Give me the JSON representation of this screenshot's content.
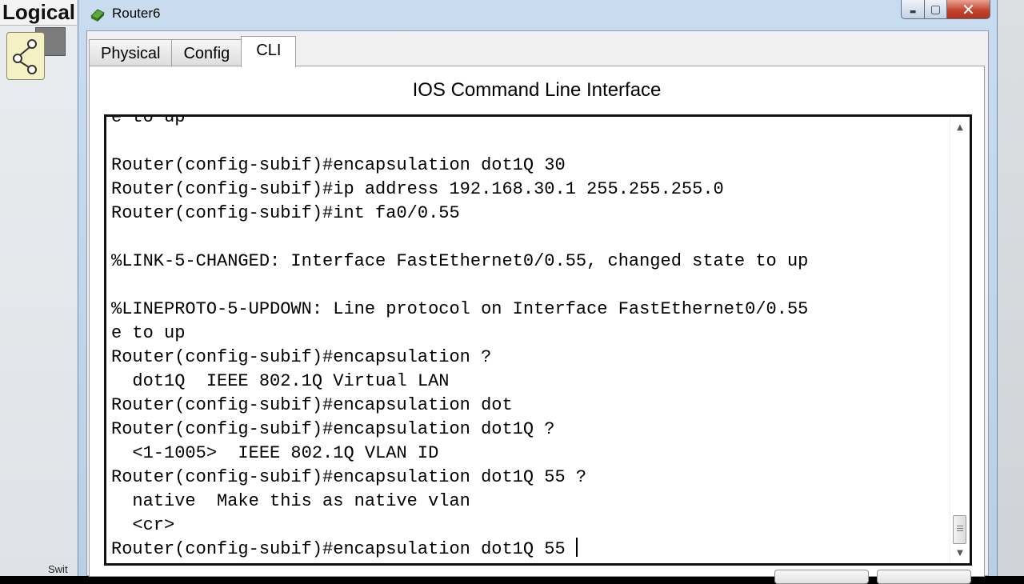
{
  "background": {
    "workspace_label": "Logical",
    "switch_label": "Swit"
  },
  "window": {
    "title": "Router6",
    "controls": {
      "minimize": "▬",
      "maximize": "▢",
      "close": "✕"
    }
  },
  "tabs": [
    {
      "label": "Physical",
      "active": false
    },
    {
      "label": "Config",
      "active": false
    },
    {
      "label": "CLI",
      "active": true
    }
  ],
  "panel": {
    "title": "IOS Command Line Interface"
  },
  "terminal": {
    "lines": [
      "e to up",
      "",
      "Router(config-subif)#encapsulation dot1Q 30",
      "Router(config-subif)#ip address 192.168.30.1 255.255.255.0",
      "Router(config-subif)#int fa0/0.55",
      "",
      "%LINK-5-CHANGED: Interface FastEthernet0/0.55, changed state to up",
      "",
      "%LINEPROTO-5-UPDOWN: Line protocol on Interface FastEthernet0/0.55",
      "e to up",
      "Router(config-subif)#encapsulation ?",
      "  dot1Q  IEEE 802.1Q Virtual LAN",
      "Router(config-subif)#encapsulation dot",
      "Router(config-subif)#encapsulation dot1Q ?",
      "  <1-1005>  IEEE 802.1Q VLAN ID",
      "Router(config-subif)#encapsulation dot1Q 55 ?",
      "  native  Make this as native vlan",
      "  <cr>",
      "Router(config-subif)#encapsulation dot1Q 55 "
    ]
  },
  "icons": {
    "app": "router-icon",
    "scroll_up": "scroll-up-arrow-icon",
    "scroll_down": "scroll-down-arrow-icon"
  }
}
